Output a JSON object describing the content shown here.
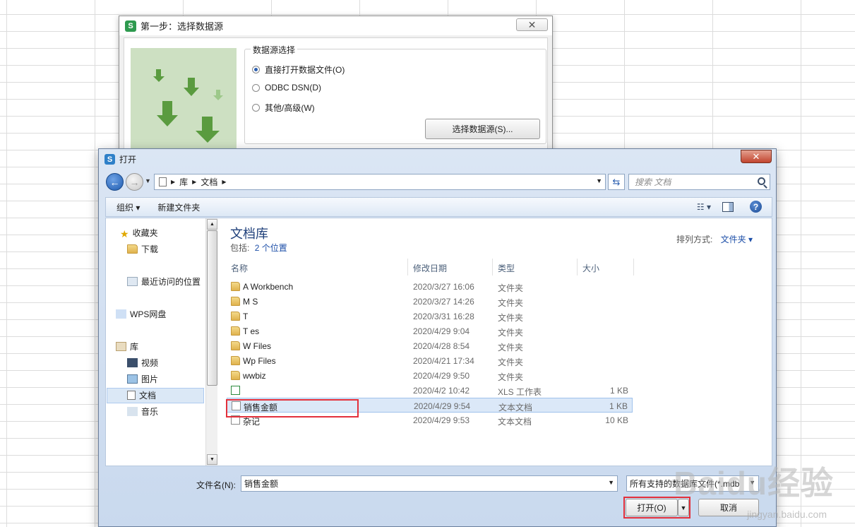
{
  "wizard": {
    "title": "第一步：选择数据源",
    "group_title": "数据源选择",
    "options": [
      {
        "label": "直接打开数据文件(O)",
        "checked": true
      },
      {
        "label": "ODBC DSN(D)",
        "checked": false
      },
      {
        "label": "其他/高级(W)",
        "checked": false
      }
    ],
    "select_button": "选择数据源(S)..."
  },
  "open_dialog": {
    "title": "打开",
    "close_label": "✕",
    "breadcrumb": [
      "库",
      "文档"
    ],
    "search_placeholder": "搜索 文档",
    "toolbar": {
      "organize": "组织 ▾",
      "new_folder": "新建文件夹"
    },
    "nav": [
      {
        "label": "收藏夹"
      },
      {
        "label": "下载"
      },
      {
        "label": "最近访问的位置"
      },
      {
        "label": "WPS网盘"
      },
      {
        "label": "库"
      },
      {
        "label": "视频"
      },
      {
        "label": "图片"
      },
      {
        "label": "文档"
      },
      {
        "label": "音乐"
      }
    ],
    "library": {
      "title": "文档库",
      "includes_label": "包括:",
      "includes_link": "2 个位置",
      "arrange_label": "排列方式:",
      "arrange_value": "文件夹 ▾"
    },
    "columns": [
      "名称",
      "修改日期",
      "类型",
      "大小"
    ],
    "files": [
      {
        "name": "A    Workbench",
        "date": "2020/3/27 16:06",
        "type": "文件夹",
        "size": "",
        "kind": "folder"
      },
      {
        "name": "M    S",
        "date": "2020/3/27 14:26",
        "type": "文件夹",
        "size": "",
        "kind": "folder"
      },
      {
        "name": "T",
        "date": "2020/3/31 16:28",
        "type": "文件夹",
        "size": "",
        "kind": "folder"
      },
      {
        "name": "T         es",
        "date": "2020/4/29 9:04",
        "type": "文件夹",
        "size": "",
        "kind": "folder"
      },
      {
        "name": "W        Files",
        "date": "2020/4/28 8:54",
        "type": "文件夹",
        "size": "",
        "kind": "folder"
      },
      {
        "name": "Wp        Files",
        "date": "2020/4/21 17:34",
        "type": "文件夹",
        "size": "",
        "kind": "folder"
      },
      {
        "name": "wwbiz",
        "date": "2020/4/29 9:50",
        "type": "文件夹",
        "size": "",
        "kind": "folder"
      },
      {
        "name": "",
        "date": "2020/4/2 10:42",
        "type": "XLS 工作表",
        "size": "1 KB",
        "kind": "xls"
      },
      {
        "name": "销售金额",
        "date": "2020/4/29 9:54",
        "type": "文本文档",
        "size": "1 KB",
        "kind": "txt",
        "selected": true
      },
      {
        "name": "杂记",
        "date": "2020/4/29 9:53",
        "type": "文本文档",
        "size": "10 KB",
        "kind": "txt"
      }
    ],
    "filename_label": "文件名(N):",
    "filename_value": "销售金额",
    "filter_value": "所有支持的数据库文件(*.mdb",
    "open_button": "打开(O)",
    "cancel_button": "取消"
  },
  "watermark": {
    "main": "Baidu经验",
    "sub": "jingyan.baidu.com"
  },
  "colors": {
    "highlight_box": "#e3303b",
    "selection": "#dbe8f8",
    "link": "#1d4fa8"
  }
}
